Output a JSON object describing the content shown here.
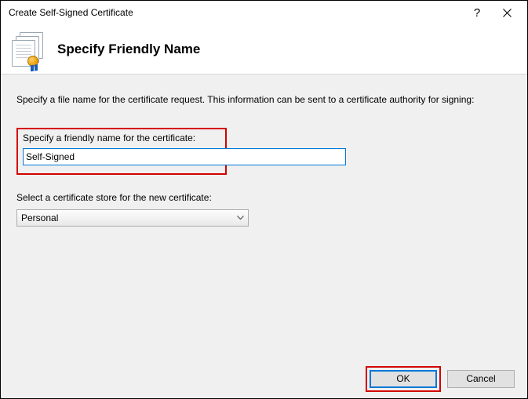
{
  "window": {
    "title": "Create Self-Signed Certificate"
  },
  "banner": {
    "heading": "Specify Friendly Name"
  },
  "body": {
    "instruction": "Specify a file name for the certificate request.  This information can be sent to a certificate authority for signing:",
    "friendly_name_label": "Specify a friendly name for the certificate:",
    "friendly_name_value": "Self-Signed",
    "store_label": "Select a certificate store for the new certificate:",
    "store_selected": "Personal"
  },
  "footer": {
    "ok_label": "OK",
    "cancel_label": "Cancel"
  }
}
